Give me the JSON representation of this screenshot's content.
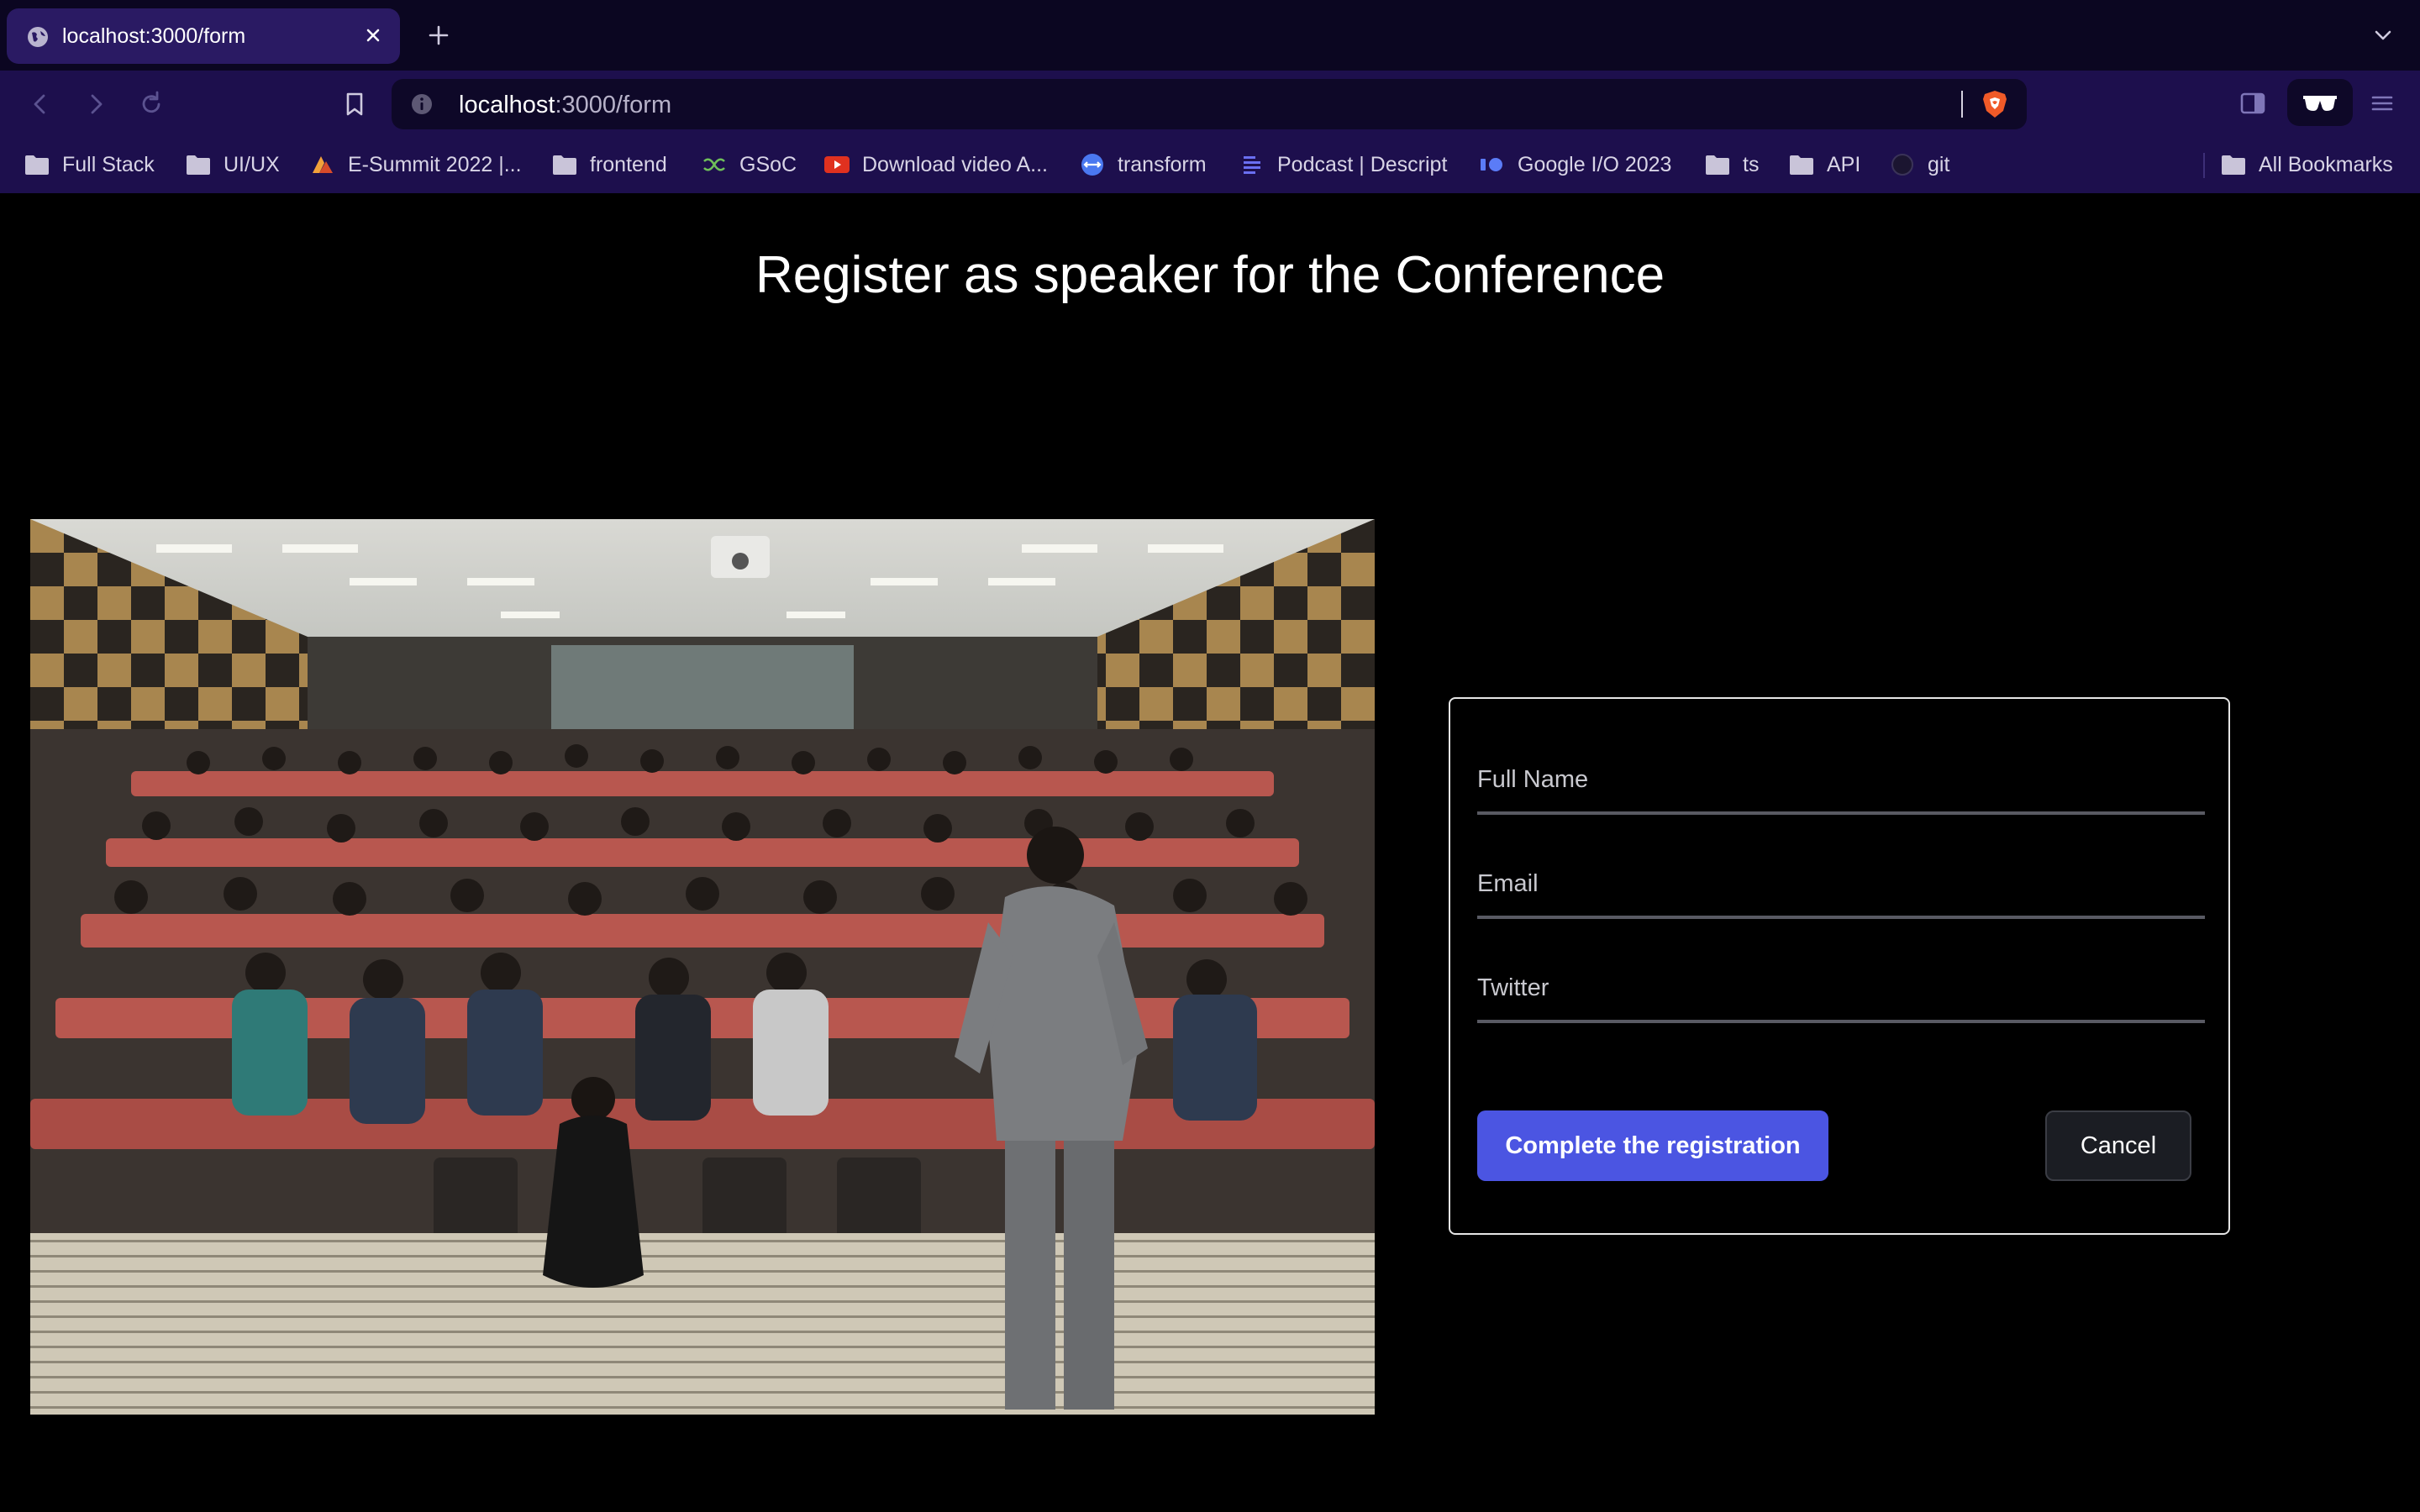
{
  "browser": {
    "tab": {
      "title": "localhost:3000/form"
    },
    "url": {
      "host": "localhost",
      "path": ":3000/form"
    },
    "bookmarks": [
      {
        "label": "Full Stack",
        "icon": "folder-icon"
      },
      {
        "label": "UI/UX",
        "icon": "folder-icon"
      },
      {
        "label": "E-Summit 2022 |...",
        "icon": "esummit-icon"
      },
      {
        "label": "frontend",
        "icon": "folder-icon"
      },
      {
        "label": "GSoC",
        "icon": "gsoc-icon"
      },
      {
        "label": "Download video A...",
        "icon": "youtube-icon"
      },
      {
        "label": "transform",
        "icon": "transform-icon"
      },
      {
        "label": "Podcast | Descript",
        "icon": "descript-icon"
      },
      {
        "label": "Google I/O 2023",
        "icon": "google-io-icon"
      },
      {
        "label": "ts",
        "icon": "folder-icon"
      },
      {
        "label": "API",
        "icon": "folder-icon"
      },
      {
        "label": "git",
        "icon": "github-icon"
      }
    ],
    "all_bookmarks": "All Bookmarks"
  },
  "page": {
    "heading": "Register as speaker for the Conference",
    "form": {
      "full_name_placeholder": "Full Name",
      "email_placeholder": "Email",
      "twitter_placeholder": "Twitter",
      "submit_label": "Complete the registration",
      "cancel_label": "Cancel"
    }
  },
  "colors": {
    "tabstrip_bg": "#0b0621",
    "toolbar_bg": "#1d0f4d",
    "active_tab_bg": "#2a1a63",
    "page_bg": "#000000",
    "primary_button": "#4b55e2",
    "secondary_button": "#1b1d23"
  }
}
